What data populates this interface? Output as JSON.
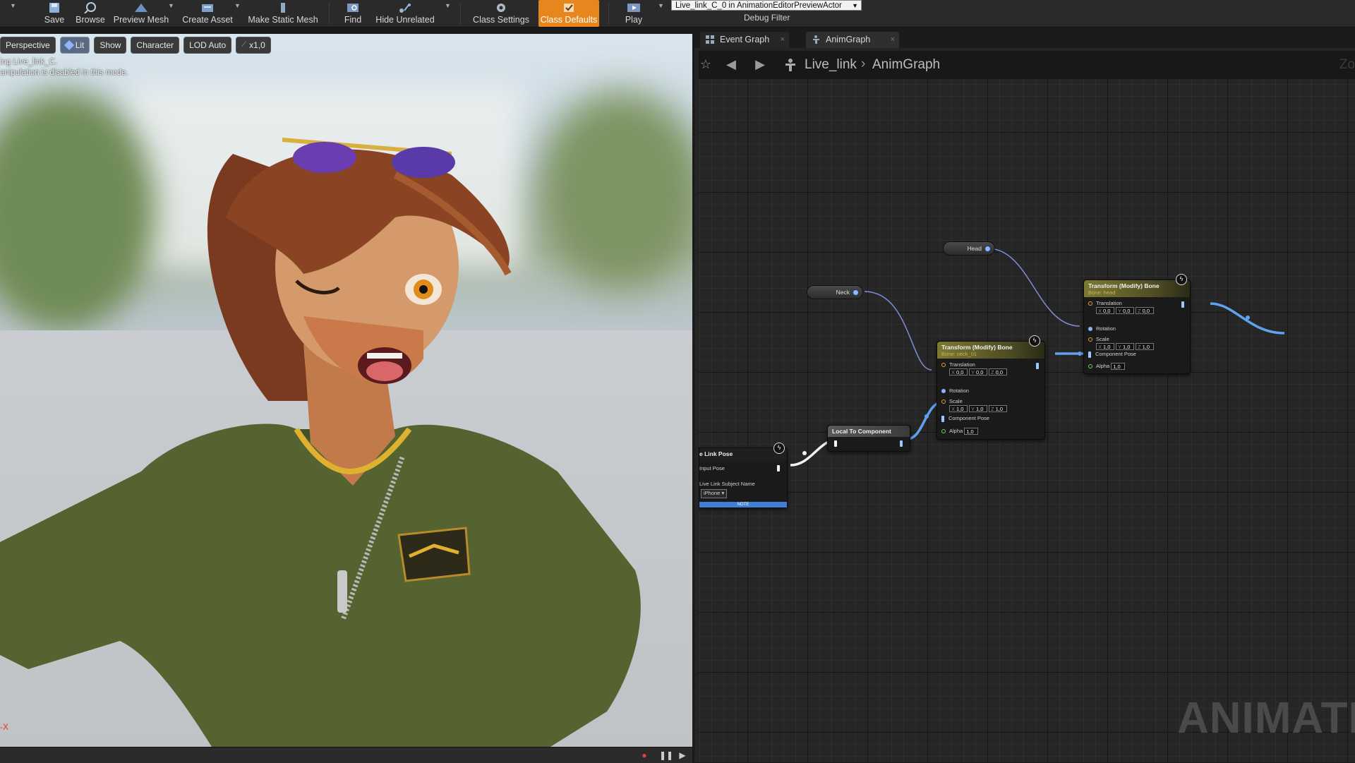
{
  "toolbar": {
    "items": [
      {
        "label": "Save",
        "icon": "save-icon"
      },
      {
        "label": "Browse",
        "icon": "browse-icon"
      },
      {
        "label": "Preview Mesh",
        "icon": "preview-mesh-icon"
      },
      {
        "label": "Create Asset",
        "icon": "create-asset-icon"
      },
      {
        "label": "Make Static Mesh",
        "icon": "make-static-mesh-icon"
      },
      {
        "label": "Find",
        "icon": "find-icon"
      },
      {
        "label": "Hide Unrelated",
        "icon": "hide-unrelated-icon"
      },
      {
        "label": "Class Settings",
        "icon": "gear-icon"
      },
      {
        "label": "Class Defaults",
        "icon": "class-defaults-icon",
        "active": true
      },
      {
        "label": "Play",
        "icon": "play-icon"
      }
    ],
    "debug_select_value": "Live_link_C_0 in AnimationEditorPreviewActor",
    "debug_filter_label": "Debug Filter",
    "accent": "#e8861e"
  },
  "viewport": {
    "buttons": {
      "perspective": "Perspective",
      "lit": "Lit",
      "show": "Show",
      "character": "Character",
      "lod": "LOD Auto",
      "speed": "x1,0"
    },
    "info_line_1": "ing Live_link_C.",
    "info_line_2": "anipulation is disabled in this mode.",
    "axis_label": "-X"
  },
  "graph": {
    "tabs": [
      {
        "label": "Event Graph",
        "icon": "event-graph-icon"
      },
      {
        "label": "AnimGraph",
        "icon": "anim-graph-icon",
        "active": true
      }
    ],
    "breadcrumb": {
      "root": "Live_link",
      "current": "AnimGraph"
    },
    "zoom_label": "Zo",
    "watermark": "ANIMATIO",
    "nodes": {
      "head_var": "Head",
      "neck_var": "Neck",
      "tmb_head": {
        "title": "Transform (Modify) Bone",
        "subtitle": "Bone: head",
        "translation_label": "Translation",
        "translation": [
          "0,0",
          "0,0",
          "0,0"
        ],
        "rotation_label": "Rotation",
        "scale_label": "Scale",
        "scale": [
          "1,0",
          "1,0",
          "1,0"
        ],
        "component_pose_label": "Component Pose",
        "alpha_label": "Alpha",
        "alpha": "1,0"
      },
      "tmb_neck": {
        "title": "Transform (Modify) Bone",
        "subtitle": "Bone: neck_01",
        "translation_label": "Translation",
        "translation": [
          "0,0",
          "0,0",
          "0,0"
        ],
        "rotation_label": "Rotation",
        "scale_label": "Scale",
        "scale": [
          "1,0",
          "1,0",
          "1,0"
        ],
        "component_pose_label": "Component Pose",
        "alpha_label": "Alpha",
        "alpha": "1,0"
      },
      "local_to_component": {
        "title": "Local To Component"
      },
      "live_link_pose": {
        "title": "e Link Pose",
        "input_pose_label": "Input Pose",
        "subject_label": "Live Link Subject Name",
        "subject_value": "iPhone",
        "note": "NOTE"
      }
    },
    "axis_labels": [
      "X",
      "Y",
      "Z"
    ]
  }
}
